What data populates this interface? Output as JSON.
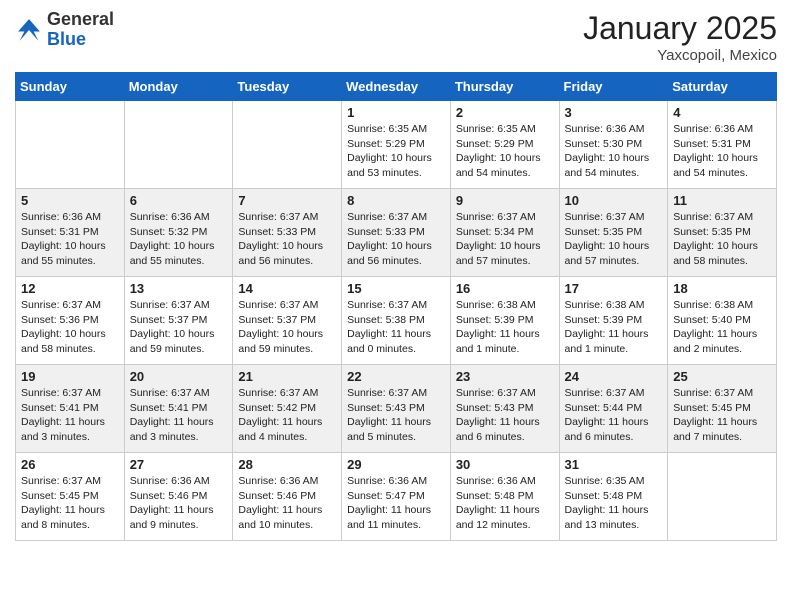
{
  "header": {
    "logo_general": "General",
    "logo_blue": "Blue",
    "month": "January 2025",
    "location": "Yaxcopoil, Mexico"
  },
  "weekdays": [
    "Sunday",
    "Monday",
    "Tuesday",
    "Wednesday",
    "Thursday",
    "Friday",
    "Saturday"
  ],
  "weeks": [
    [
      {
        "date": "",
        "sunrise": "",
        "sunset": "",
        "daylight": ""
      },
      {
        "date": "",
        "sunrise": "",
        "sunset": "",
        "daylight": ""
      },
      {
        "date": "",
        "sunrise": "",
        "sunset": "",
        "daylight": ""
      },
      {
        "date": "1",
        "sunrise": "Sunrise: 6:35 AM",
        "sunset": "Sunset: 5:29 PM",
        "daylight": "Daylight: 10 hours and 53 minutes."
      },
      {
        "date": "2",
        "sunrise": "Sunrise: 6:35 AM",
        "sunset": "Sunset: 5:29 PM",
        "daylight": "Daylight: 10 hours and 54 minutes."
      },
      {
        "date": "3",
        "sunrise": "Sunrise: 6:36 AM",
        "sunset": "Sunset: 5:30 PM",
        "daylight": "Daylight: 10 hours and 54 minutes."
      },
      {
        "date": "4",
        "sunrise": "Sunrise: 6:36 AM",
        "sunset": "Sunset: 5:31 PM",
        "daylight": "Daylight: 10 hours and 54 minutes."
      }
    ],
    [
      {
        "date": "5",
        "sunrise": "Sunrise: 6:36 AM",
        "sunset": "Sunset: 5:31 PM",
        "daylight": "Daylight: 10 hours and 55 minutes."
      },
      {
        "date": "6",
        "sunrise": "Sunrise: 6:36 AM",
        "sunset": "Sunset: 5:32 PM",
        "daylight": "Daylight: 10 hours and 55 minutes."
      },
      {
        "date": "7",
        "sunrise": "Sunrise: 6:37 AM",
        "sunset": "Sunset: 5:33 PM",
        "daylight": "Daylight: 10 hours and 56 minutes."
      },
      {
        "date": "8",
        "sunrise": "Sunrise: 6:37 AM",
        "sunset": "Sunset: 5:33 PM",
        "daylight": "Daylight: 10 hours and 56 minutes."
      },
      {
        "date": "9",
        "sunrise": "Sunrise: 6:37 AM",
        "sunset": "Sunset: 5:34 PM",
        "daylight": "Daylight: 10 hours and 57 minutes."
      },
      {
        "date": "10",
        "sunrise": "Sunrise: 6:37 AM",
        "sunset": "Sunset: 5:35 PM",
        "daylight": "Daylight: 10 hours and 57 minutes."
      },
      {
        "date": "11",
        "sunrise": "Sunrise: 6:37 AM",
        "sunset": "Sunset: 5:35 PM",
        "daylight": "Daylight: 10 hours and 58 minutes."
      }
    ],
    [
      {
        "date": "12",
        "sunrise": "Sunrise: 6:37 AM",
        "sunset": "Sunset: 5:36 PM",
        "daylight": "Daylight: 10 hours and 58 minutes."
      },
      {
        "date": "13",
        "sunrise": "Sunrise: 6:37 AM",
        "sunset": "Sunset: 5:37 PM",
        "daylight": "Daylight: 10 hours and 59 minutes."
      },
      {
        "date": "14",
        "sunrise": "Sunrise: 6:37 AM",
        "sunset": "Sunset: 5:37 PM",
        "daylight": "Daylight: 10 hours and 59 minutes."
      },
      {
        "date": "15",
        "sunrise": "Sunrise: 6:37 AM",
        "sunset": "Sunset: 5:38 PM",
        "daylight": "Daylight: 11 hours and 0 minutes."
      },
      {
        "date": "16",
        "sunrise": "Sunrise: 6:38 AM",
        "sunset": "Sunset: 5:39 PM",
        "daylight": "Daylight: 11 hours and 1 minute."
      },
      {
        "date": "17",
        "sunrise": "Sunrise: 6:38 AM",
        "sunset": "Sunset: 5:39 PM",
        "daylight": "Daylight: 11 hours and 1 minute."
      },
      {
        "date": "18",
        "sunrise": "Sunrise: 6:38 AM",
        "sunset": "Sunset: 5:40 PM",
        "daylight": "Daylight: 11 hours and 2 minutes."
      }
    ],
    [
      {
        "date": "19",
        "sunrise": "Sunrise: 6:37 AM",
        "sunset": "Sunset: 5:41 PM",
        "daylight": "Daylight: 11 hours and 3 minutes."
      },
      {
        "date": "20",
        "sunrise": "Sunrise: 6:37 AM",
        "sunset": "Sunset: 5:41 PM",
        "daylight": "Daylight: 11 hours and 3 minutes."
      },
      {
        "date": "21",
        "sunrise": "Sunrise: 6:37 AM",
        "sunset": "Sunset: 5:42 PM",
        "daylight": "Daylight: 11 hours and 4 minutes."
      },
      {
        "date": "22",
        "sunrise": "Sunrise: 6:37 AM",
        "sunset": "Sunset: 5:43 PM",
        "daylight": "Daylight: 11 hours and 5 minutes."
      },
      {
        "date": "23",
        "sunrise": "Sunrise: 6:37 AM",
        "sunset": "Sunset: 5:43 PM",
        "daylight": "Daylight: 11 hours and 6 minutes."
      },
      {
        "date": "24",
        "sunrise": "Sunrise: 6:37 AM",
        "sunset": "Sunset: 5:44 PM",
        "daylight": "Daylight: 11 hours and 6 minutes."
      },
      {
        "date": "25",
        "sunrise": "Sunrise: 6:37 AM",
        "sunset": "Sunset: 5:45 PM",
        "daylight": "Daylight: 11 hours and 7 minutes."
      }
    ],
    [
      {
        "date": "26",
        "sunrise": "Sunrise: 6:37 AM",
        "sunset": "Sunset: 5:45 PM",
        "daylight": "Daylight: 11 hours and 8 minutes."
      },
      {
        "date": "27",
        "sunrise": "Sunrise: 6:36 AM",
        "sunset": "Sunset: 5:46 PM",
        "daylight": "Daylight: 11 hours and 9 minutes."
      },
      {
        "date": "28",
        "sunrise": "Sunrise: 6:36 AM",
        "sunset": "Sunset: 5:46 PM",
        "daylight": "Daylight: 11 hours and 10 minutes."
      },
      {
        "date": "29",
        "sunrise": "Sunrise: 6:36 AM",
        "sunset": "Sunset: 5:47 PM",
        "daylight": "Daylight: 11 hours and 11 minutes."
      },
      {
        "date": "30",
        "sunrise": "Sunrise: 6:36 AM",
        "sunset": "Sunset: 5:48 PM",
        "daylight": "Daylight: 11 hours and 12 minutes."
      },
      {
        "date": "31",
        "sunrise": "Sunrise: 6:35 AM",
        "sunset": "Sunset: 5:48 PM",
        "daylight": "Daylight: 11 hours and 13 minutes."
      },
      {
        "date": "",
        "sunrise": "",
        "sunset": "",
        "daylight": ""
      }
    ]
  ],
  "row_shading": [
    false,
    true,
    false,
    true,
    false
  ]
}
